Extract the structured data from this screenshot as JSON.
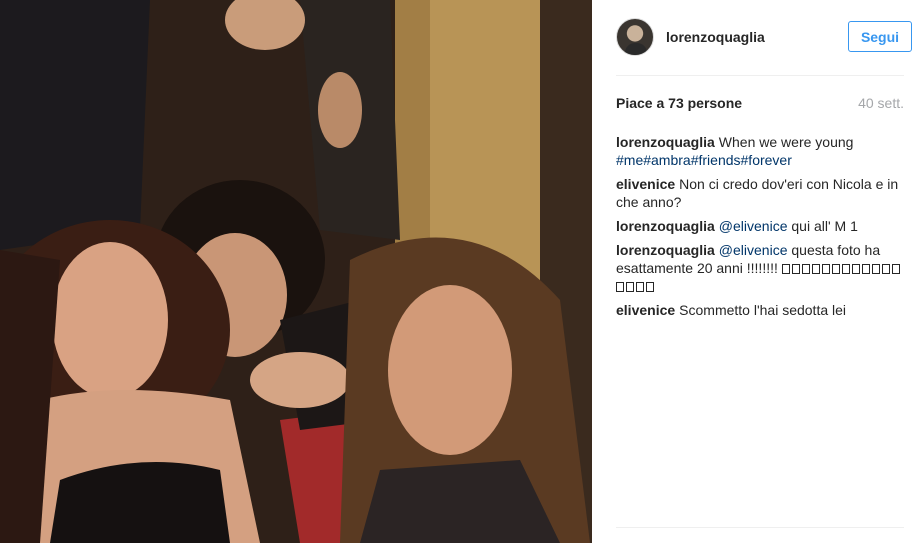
{
  "post": {
    "username": "lorenzoquaglia",
    "follow_label": "Segui",
    "likes": "Piace a 73 persone",
    "time": "40 sett."
  },
  "comments": [
    {
      "user": "lorenzoquaglia",
      "text": "When we were young",
      "tags": [
        "#me",
        "#ambra",
        "#friends",
        "#forever"
      ]
    },
    {
      "user": "elivenice",
      "text": "Non ci credo dov'eri con Nicola e in che anno?"
    },
    {
      "user": "lorenzoquaglia",
      "mention": "@elivenice",
      "text": "qui all' M 1"
    },
    {
      "user": "lorenzoquaglia",
      "mention": "@elivenice",
      "text": "questa foto ha esattamente 20 anni !!!!!!!!",
      "emoji_count": 16
    },
    {
      "user": "elivenice",
      "text": "Scommetto l'hai sedotta lei"
    }
  ],
  "icons": {
    "avatar": "profile-avatar"
  },
  "colors": {
    "accent": "#3897f0",
    "hashtag": "#003569",
    "muted": "#a5a7aa",
    "divider": "#efefef"
  }
}
